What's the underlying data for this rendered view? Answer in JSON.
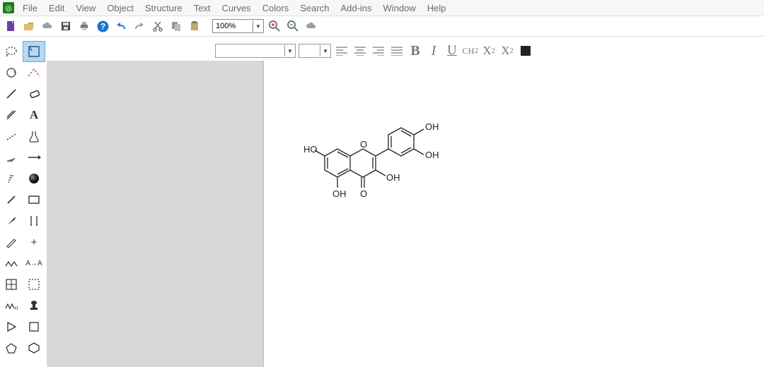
{
  "app_icon_text": "◎",
  "menu": [
    "File",
    "Edit",
    "View",
    "Object",
    "Structure",
    "Text",
    "Curves",
    "Colors",
    "Search",
    "Add-ins",
    "Window",
    "Help"
  ],
  "toolbar": {
    "zoom_value": "100%"
  },
  "format_bar": {
    "font_value": "",
    "size_value": "",
    "bold": "B",
    "italic": "I",
    "underline": "U",
    "chem_formula": "CH",
    "chem_formula_sub": "2",
    "sub_label": "X",
    "sub_sub": "2",
    "sup_label": "X",
    "sup_sup": "2"
  },
  "side_tools": {
    "text_tool_label": "A",
    "atom_plus_label": "+",
    "replace_label": "A→A"
  },
  "molecule": {
    "labels": {
      "ho_left": "HO",
      "oh_top_right": "OH",
      "oh_right": "OH",
      "oh_center": "OH",
      "oh_bottom": "OH",
      "o_ring": "O",
      "o_keto": "O"
    }
  }
}
